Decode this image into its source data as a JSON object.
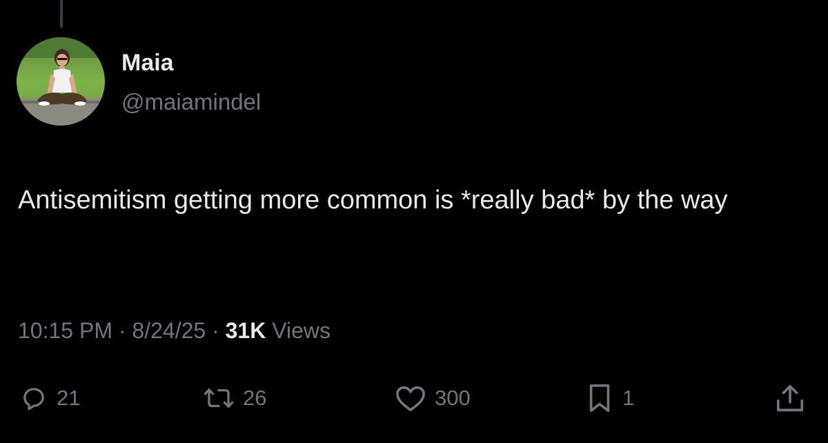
{
  "author": {
    "name": "Maia",
    "handle": "@maiamindel",
    "avatar_icon": "profile-photo"
  },
  "tweet": {
    "text": "Antisemitism getting more common is *really bad* by the way",
    "time": "10:15 PM",
    "date": "8/24/25",
    "views_count": "31K",
    "views_label": "Views",
    "separator": "·"
  },
  "actions": {
    "reply": {
      "icon": "reply-icon",
      "count": "21"
    },
    "repost": {
      "icon": "repost-icon",
      "count": "26"
    },
    "like": {
      "icon": "heart-icon",
      "count": "300"
    },
    "bookmark": {
      "icon": "bookmark-icon",
      "count": "1"
    },
    "share": {
      "icon": "share-icon"
    }
  },
  "colors": {
    "background": "#000000",
    "primary_text": "#e7e9ea",
    "secondary_text": "#71767b"
  }
}
